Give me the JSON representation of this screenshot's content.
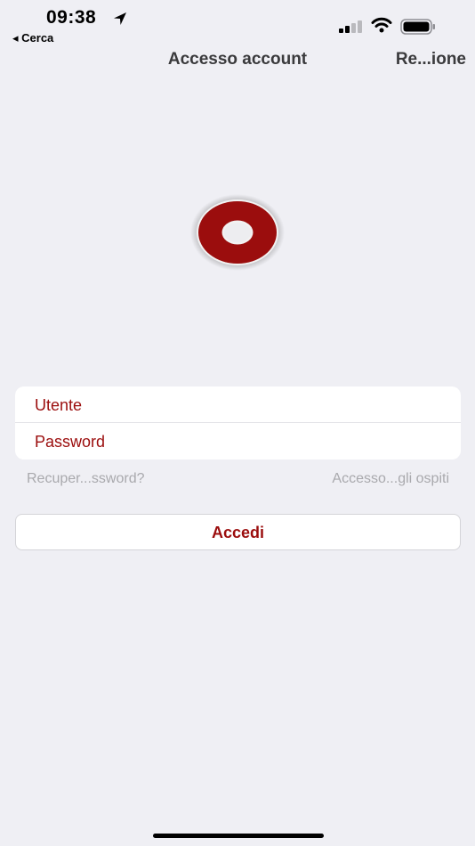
{
  "status_bar": {
    "time": "09:38",
    "back_label": "◂ Cerca",
    "icons": [
      "location-arrow-icon",
      "cellular-signal-icon",
      "wifi-icon",
      "battery-icon"
    ]
  },
  "nav": {
    "title": "Accesso account",
    "right_label": "Re...ione"
  },
  "logo": {
    "icon": "ring-logo-icon",
    "color": "#9b0d0d"
  },
  "form": {
    "username_placeholder": "Utente",
    "password_placeholder": "Password"
  },
  "links": {
    "recover_password": "Recuper...ssword?",
    "guest_access": "Accesso...gli ospiti"
  },
  "login_button": {
    "label": "Accedi"
  },
  "colors": {
    "accent": "#9b0d0d",
    "background": "#efeff4",
    "link_gray": "#a9a9ad"
  }
}
